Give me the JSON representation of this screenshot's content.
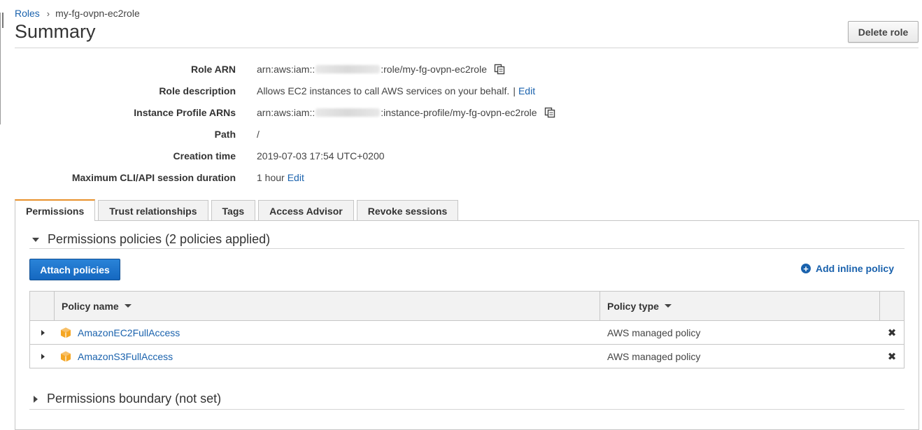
{
  "breadcrumb": {
    "parent": "Roles",
    "separator": "›",
    "current": "my-fg-ovpn-ec2role"
  },
  "page": {
    "title": "Summary",
    "delete_label": "Delete role"
  },
  "summary": {
    "role_arn": {
      "label": "Role ARN",
      "prefix": "arn:aws:iam::",
      "suffix": ":role/my-fg-ovpn-ec2role"
    },
    "role_description": {
      "label": "Role description",
      "value": "Allows EC2 instances to call AWS services on your behalf.",
      "separator": "|",
      "edit": "Edit"
    },
    "instance_profile": {
      "label": "Instance Profile ARNs",
      "prefix": "arn:aws:iam::",
      "suffix": ":instance-profile/my-fg-ovpn-ec2role"
    },
    "path": {
      "label": "Path",
      "value": "/"
    },
    "creation_time": {
      "label": "Creation time",
      "value": "2019-07-03 17:54 UTC+0200"
    },
    "max_session": {
      "label": "Maximum CLI/API session duration",
      "value": "1 hour",
      "edit": "Edit"
    }
  },
  "tabs": [
    {
      "label": "Permissions",
      "active": true
    },
    {
      "label": "Trust relationships",
      "active": false
    },
    {
      "label": "Tags",
      "active": false
    },
    {
      "label": "Access Advisor",
      "active": false
    },
    {
      "label": "Revoke sessions",
      "active": false
    }
  ],
  "permissions": {
    "policies_header": "Permissions policies (2 policies applied)",
    "attach_label": "Attach policies",
    "add_inline_label": "Add inline policy",
    "columns": {
      "name": "Policy name",
      "type": "Policy type"
    },
    "rows": [
      {
        "name": "AmazonEC2FullAccess",
        "type": "AWS managed policy",
        "remove": "✖"
      },
      {
        "name": "AmazonS3FullAccess",
        "type": "AWS managed policy",
        "remove": "✖"
      }
    ],
    "boundary_header": "Permissions boundary (not set)"
  },
  "colors": {
    "link": "#1a62ad",
    "primary": "#1b73c9",
    "active_tab": "#e8912b",
    "policy_icon": "#f5a623"
  }
}
